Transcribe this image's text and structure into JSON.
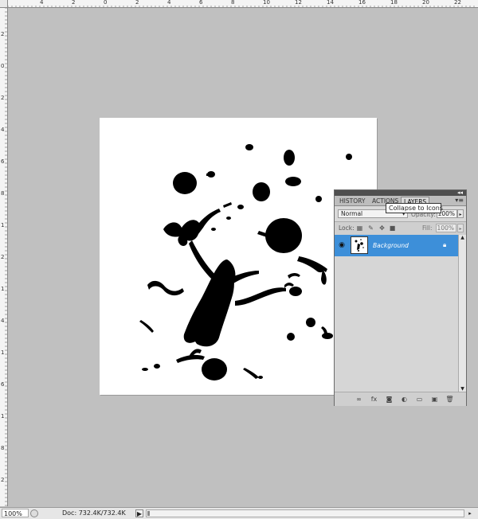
{
  "rulers": {
    "top_labels": [
      "4",
      "2",
      "0",
      "2",
      "4",
      "6",
      "8",
      "10",
      "12",
      "14",
      "16",
      "18",
      "20",
      "22"
    ],
    "left_labels": [
      "2",
      "0",
      "2",
      "4",
      "6",
      "8",
      "1",
      "2",
      "1",
      "4",
      "1",
      "6",
      "1",
      "8",
      "2"
    ]
  },
  "status_bar": {
    "zoom": "100%",
    "doc_info": "Doc: 732.4K/732.4K",
    "arrow": "▶"
  },
  "layers_panel": {
    "tabs": [
      {
        "label": "HISTORY",
        "active": false
      },
      {
        "label": "ACTIONS",
        "active": false
      },
      {
        "label": "LAYERS",
        "active": true
      }
    ],
    "collapse_glyph": "◂◂",
    "menu_glyph": "▾≡",
    "blend_mode": "Normal",
    "opacity_label": "Opacity:",
    "opacity_value": "100%",
    "tooltip": "Collapse to Icons",
    "lock_label": "Lock:",
    "fill_label": "Fill:",
    "fill_value": "100%",
    "layers": [
      {
        "name": "Background",
        "selected": true,
        "locked": true
      }
    ],
    "bottom_icons": [
      "link-layers-icon",
      "fx-icon",
      "mask-icon",
      "adjustment-icon",
      "group-icon",
      "new-layer-icon",
      "trash-icon"
    ]
  },
  "colors": {
    "workspace": "#c0c0c0",
    "canvas": "#ffffff",
    "selected_layer": "#3d8fd9",
    "ink": "#000000"
  }
}
